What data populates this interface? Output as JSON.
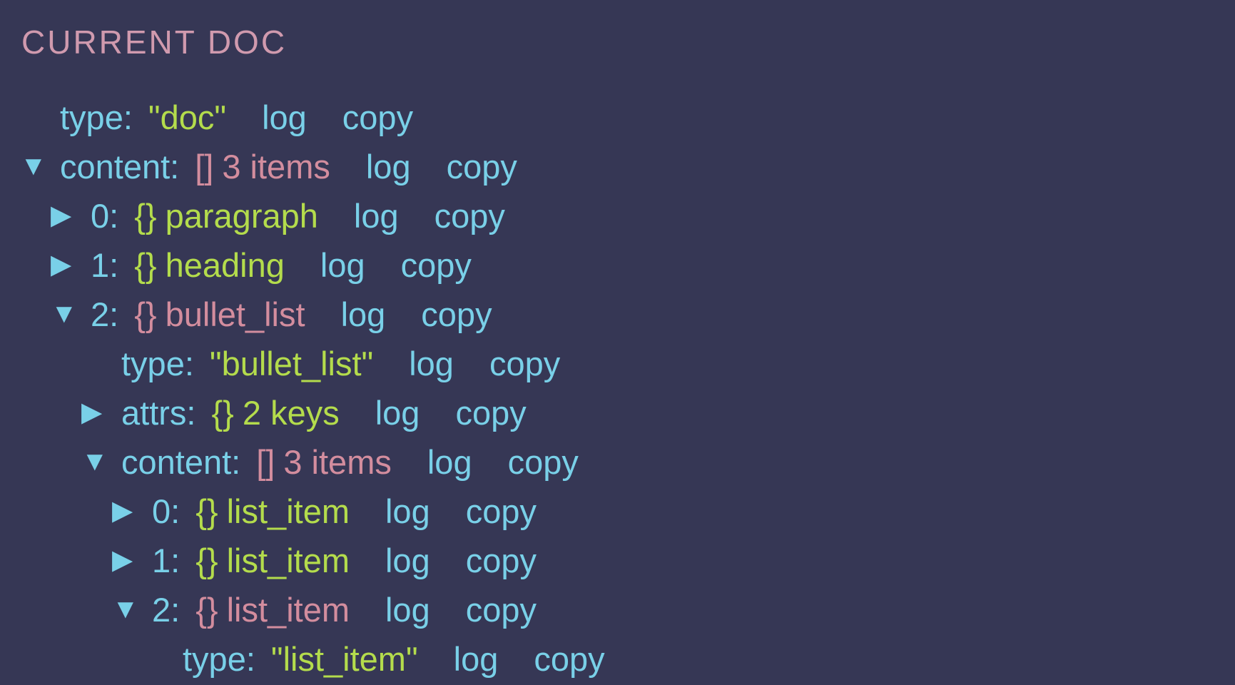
{
  "panel": {
    "title": "CURRENT DOC"
  },
  "actions": {
    "log": "log",
    "copy": "copy"
  },
  "icons": {
    "expanded": "triangle-down-icon",
    "collapsed": "triangle-right-icon",
    "expanded_glyph": "▼",
    "collapsed_glyph": "▶"
  },
  "colors": {
    "background": "#363755",
    "key": "#79d0e8",
    "string": "#b4dc4c",
    "expanded_node": "#d38d9e",
    "title": "#d09aae"
  },
  "tree": [
    {
      "depth": 0,
      "toggle": "none",
      "key": "type:",
      "kind": "string",
      "value": "\"doc\""
    },
    {
      "depth": 0,
      "toggle": "expanded",
      "key": "content:",
      "kind": "array",
      "brace": "[]",
      "value": "3 items"
    },
    {
      "depth": 1,
      "toggle": "collapsed",
      "key": "0:",
      "kind": "object",
      "brace": "{}",
      "value": "paragraph"
    },
    {
      "depth": 1,
      "toggle": "collapsed",
      "key": "1:",
      "kind": "object",
      "brace": "{}",
      "value": "heading"
    },
    {
      "depth": 1,
      "toggle": "expanded",
      "key": "2:",
      "kind": "object",
      "brace": "{}",
      "value": "bullet_list"
    },
    {
      "depth": 2,
      "toggle": "none",
      "key": "type:",
      "kind": "string",
      "value": "\"bullet_list\""
    },
    {
      "depth": 2,
      "toggle": "collapsed",
      "key": "attrs:",
      "kind": "object",
      "brace": "{}",
      "value": "2 keys"
    },
    {
      "depth": 2,
      "toggle": "expanded",
      "key": "content:",
      "kind": "array",
      "brace": "[]",
      "value": "3 items"
    },
    {
      "depth": 3,
      "toggle": "collapsed",
      "key": "0:",
      "kind": "object",
      "brace": "{}",
      "value": "list_item"
    },
    {
      "depth": 3,
      "toggle": "collapsed",
      "key": "1:",
      "kind": "object",
      "brace": "{}",
      "value": "list_item"
    },
    {
      "depth": 3,
      "toggle": "expanded",
      "key": "2:",
      "kind": "object",
      "brace": "{}",
      "value": "list_item"
    },
    {
      "depth": 4,
      "toggle": "none",
      "key": "type:",
      "kind": "string",
      "value": "\"list_item\""
    }
  ]
}
